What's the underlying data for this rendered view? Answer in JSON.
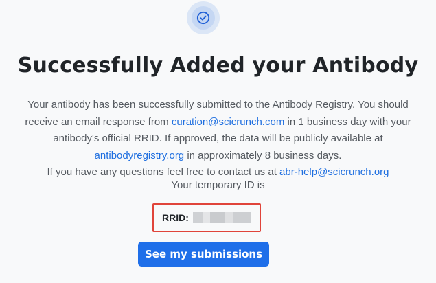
{
  "icons": {
    "success": "check-circle-icon"
  },
  "colors": {
    "accent": "#1f6fe9",
    "link": "#1f6fe0",
    "highlight_border": "#e0443a",
    "title": "#202428",
    "body_text": "#555a60",
    "background": "#f8f9fa"
  },
  "page": {
    "title": "Successfully Added your Antibody"
  },
  "message": {
    "part1": "Your antibody has been successfully submitted to the Antibody Registry. You should receive an email response from ",
    "curation_email": "curation@scicrunch.com",
    "part2": " in 1 business day with your antibody's official RRID. If approved, the data will be publicly available at ",
    "registry_link": "antibodyregistry.org",
    "part3": " in approximately 8 business days.",
    "part4": "If you have any questions feel free to contact us at ",
    "help_email": "abr-help@scicrunch.org"
  },
  "temp_id": {
    "label": "Your temporary ID is",
    "rrid_label": "RRID:"
  },
  "actions": {
    "submissions_button": "See my submissions"
  }
}
